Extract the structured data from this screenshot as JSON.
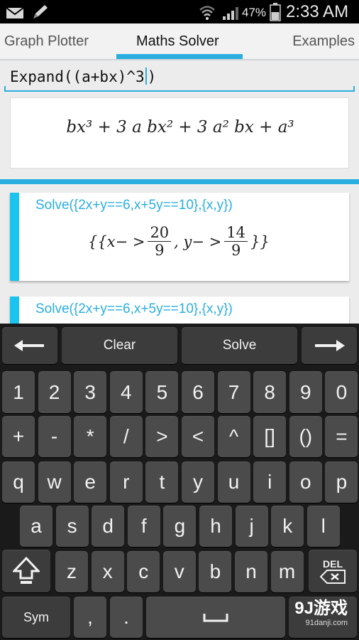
{
  "status_bar": {
    "battery_percent": "47%",
    "time": "2:33 AM"
  },
  "tabs": [
    {
      "label": "Graph Plotter"
    },
    {
      "label": "Maths Solver"
    },
    {
      "label": "Examples"
    }
  ],
  "input": {
    "before_cursor": "Expand((a+bx)^3",
    "after_cursor": ")"
  },
  "result": {
    "expression": "bx³ + 3 a bx² + 3 a² bx + a³"
  },
  "history": [
    {
      "query": "Solve({2x+y==6,x+5y==10},{x,y})",
      "answer_prefix": "{{x− >",
      "x_num": "20",
      "x_den": "9",
      "answer_mid": ", y− >",
      "y_num": "14",
      "y_den": "9",
      "answer_suffix": "}}"
    },
    {
      "query": "Solve({2x+y==6,x+5y==10},{x,y})"
    }
  ],
  "keyboard": {
    "clear": "Clear",
    "solve": "Solve",
    "row_digits": [
      "1",
      "2",
      "3",
      "4",
      "5",
      "6",
      "7",
      "8",
      "9",
      "0"
    ],
    "row_symbols": [
      "+",
      "-",
      "*",
      "/",
      ">",
      "<",
      "^",
      "[]",
      "()",
      "="
    ],
    "row_q": [
      "q",
      "w",
      "e",
      "r",
      "t",
      "y",
      "u",
      "i",
      "o",
      "p"
    ],
    "row_a": [
      "a",
      "s",
      "d",
      "f",
      "g",
      "h",
      "j",
      "k",
      "l"
    ],
    "row_z": [
      "z",
      "x",
      "c",
      "v",
      "b",
      "n",
      "m"
    ],
    "del_label": "DEL",
    "sym": "Sym",
    "comma": ",",
    "period": "."
  },
  "watermark": {
    "brand": "9J游戏",
    "site": "91danji.com"
  },
  "colors": {
    "accent": "#2aaee0",
    "card_accent": "#1bc3ef",
    "key": "#4b4b4b"
  }
}
